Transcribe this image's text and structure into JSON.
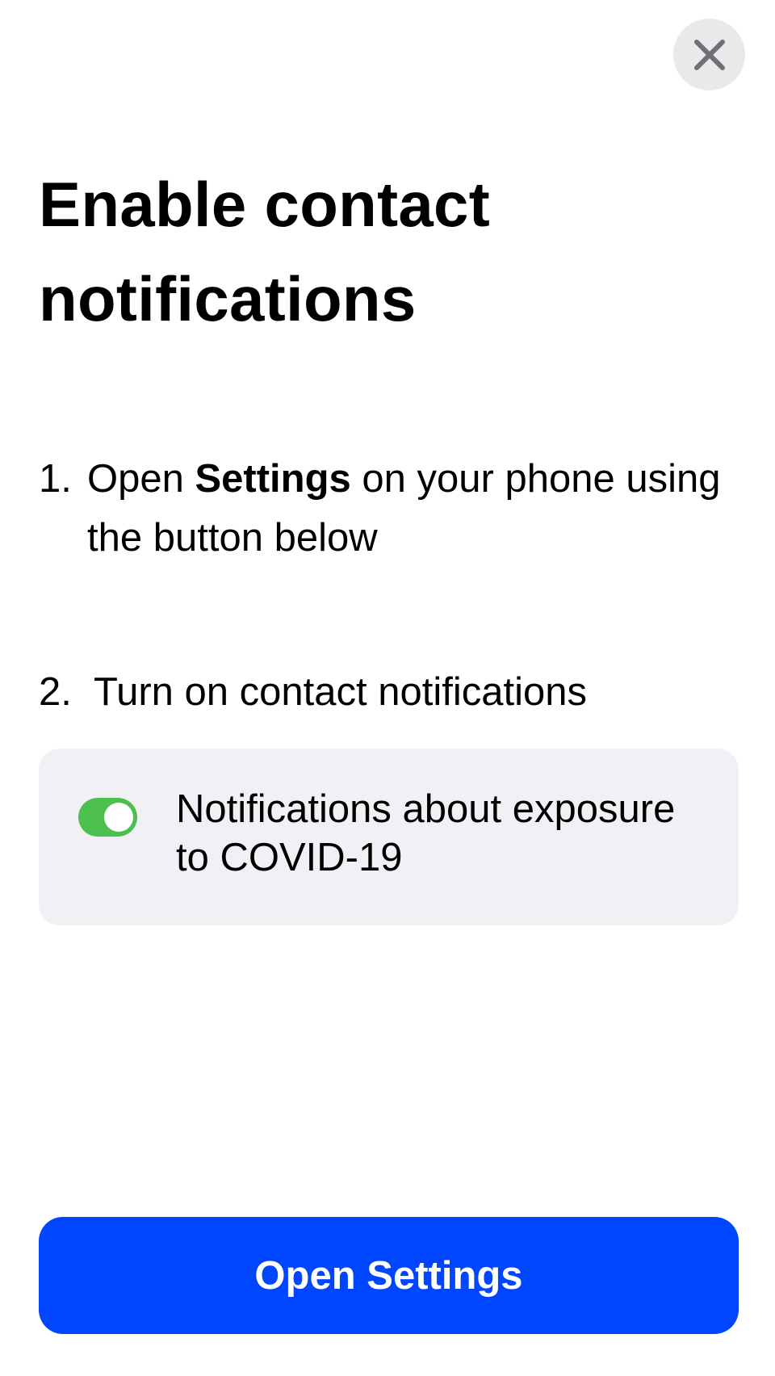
{
  "close_button": {
    "icon": "close-icon"
  },
  "title": "Enable contact notifications",
  "steps": [
    {
      "number": "1.",
      "text_before": "Open ",
      "text_bold": "Settings",
      "text_after": " on your phone using the button below"
    },
    {
      "number": "2.",
      "text": "Turn on contact notifications"
    }
  ],
  "toggle_card": {
    "label": "Notifications about exposure to COVID-19",
    "toggle_on": true,
    "toggle_color": "#4cbf4f",
    "card_color": "#f1f1f5"
  },
  "primary_button": {
    "label": "Open Settings",
    "color": "#0045ff"
  }
}
